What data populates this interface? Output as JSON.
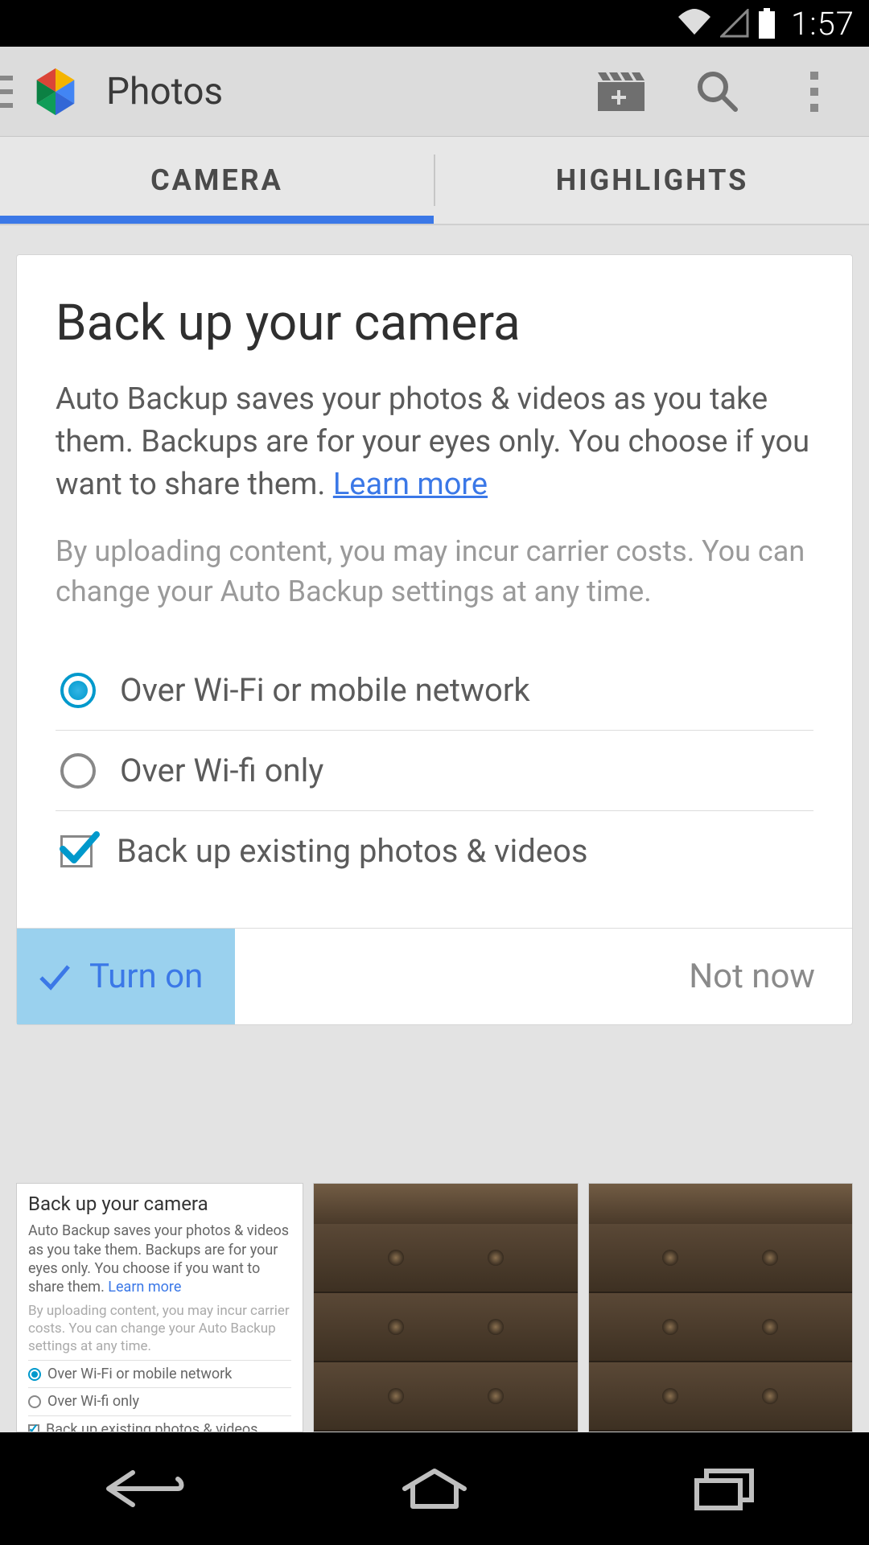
{
  "status": {
    "time": "1:57"
  },
  "header": {
    "title": "Photos",
    "icons": {
      "movie": "movie-add-icon",
      "search": "search-icon",
      "overflow": "overflow-icon"
    }
  },
  "tabs": {
    "items": [
      {
        "label": "CAMERA",
        "active": true
      },
      {
        "label": "HIGHLIGHTS",
        "active": false
      }
    ]
  },
  "card": {
    "title": "Back up your camera",
    "desc_primary": "Auto Backup saves your photos & videos as you take them. Backups are for your eyes only. You choose if you want to share them. ",
    "learn_more": "Learn more",
    "desc_secondary": "By uploading content, you may incur carrier costs. You can change your Auto Backup settings at any time.",
    "options": [
      {
        "type": "radio",
        "label": "Over Wi-Fi or mobile network",
        "checked": true
      },
      {
        "type": "radio",
        "label": "Over Wi-fi only",
        "checked": false
      },
      {
        "type": "checkbox",
        "label": "Back up existing photos & videos",
        "checked": true
      }
    ],
    "actions": {
      "confirm": "Turn on",
      "dismiss": "Not now"
    }
  },
  "thumbs": {
    "mini_card": {
      "title": "Back up your camera",
      "line1": "Auto Backup saves your photos & videos as you take them. Backups are for your eyes only. You choose if you want to share them.",
      "learn": "Learn more",
      "line2": "By uploading content, you may incur carrier costs. You can change your Auto Backup settings at any time.",
      "opt1": "Over Wi-Fi or mobile network",
      "opt2": "Over Wi-fi only",
      "opt3": "Back up existing photos & videos"
    }
  }
}
